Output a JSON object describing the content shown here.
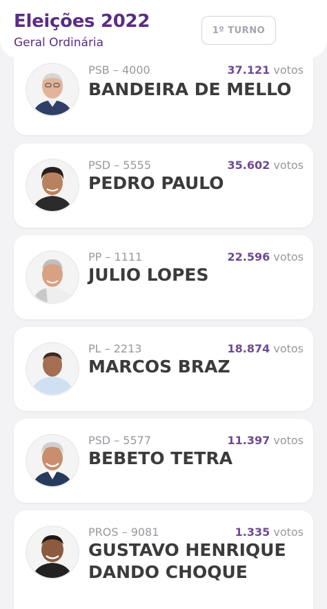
{
  "header": {
    "title": "Eleições 2022",
    "subtitle": "Geral Ordinária",
    "round_button": "1º TURNO"
  },
  "candidates": [
    {
      "party": "PSB – 4000",
      "votes": "37.121",
      "votes_suffix": "votos",
      "name": "BANDEIRA DE MELLO"
    },
    {
      "party": "PSD – 5555",
      "votes": "35.602",
      "votes_suffix": "votos",
      "name": "PEDRO PAULO"
    },
    {
      "party": "PP – 1111",
      "votes": "22.596",
      "votes_suffix": "votos",
      "name": "JULIO LOPES"
    },
    {
      "party": "PL – 2213",
      "votes": "18.874",
      "votes_suffix": "votos",
      "name": "MARCOS BRAZ"
    },
    {
      "party": "PSD – 5577",
      "votes": "11.397",
      "votes_suffix": "votos",
      "name": "BEBETO TETRA"
    },
    {
      "party": "PROS – 9081",
      "votes": "1.335",
      "votes_suffix": "votos",
      "name": "GUSTAVO HENRIQUE DANDO CHOQUE"
    }
  ],
  "colors": {
    "brand": "#5a2d86",
    "votes_number": "#6e4a93",
    "muted": "#9a96a0",
    "name": "#3b3b3b"
  }
}
